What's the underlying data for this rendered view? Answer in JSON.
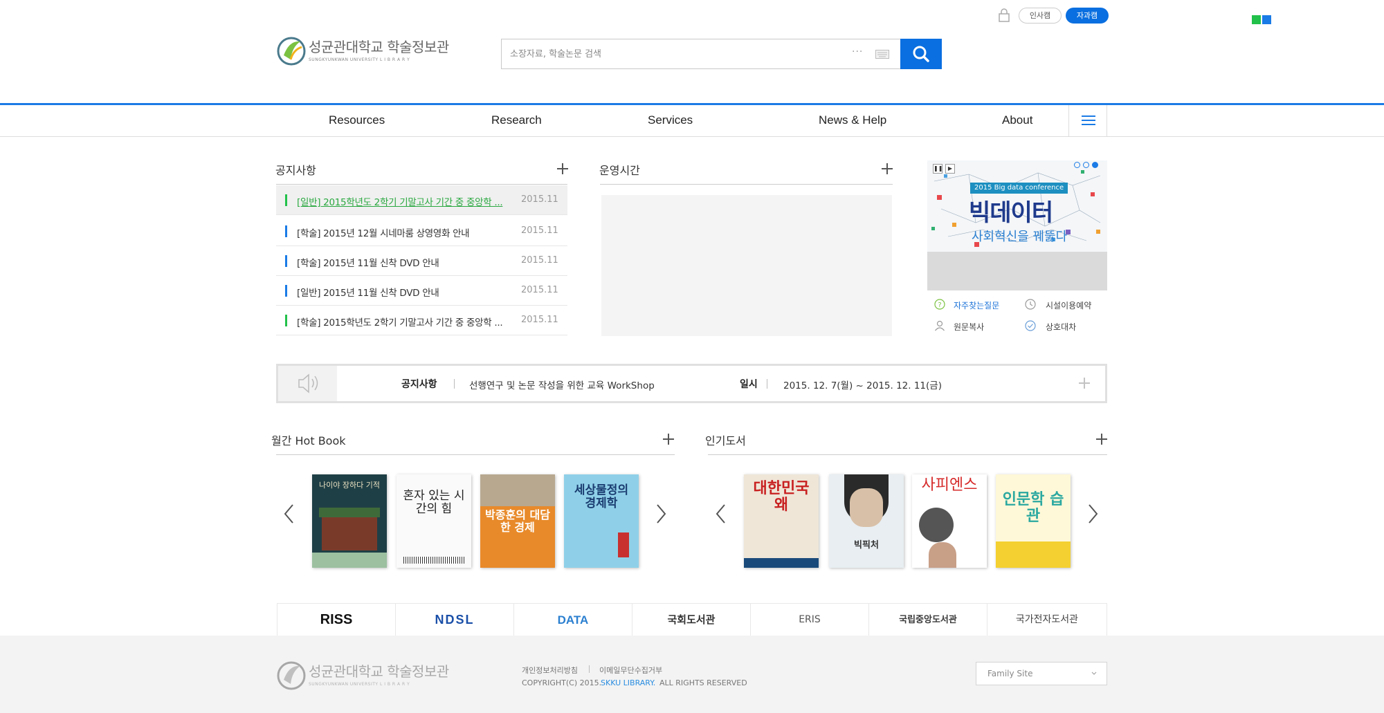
{
  "header": {
    "btn_insa": "인사캠",
    "btn_jagwa": "자과캠",
    "logo_text": "성균관대학교 학술정보관",
    "logo_sub": "SUNGKYUNKWAN UNIVERSITY   L I B R A R Y",
    "search_placeholder": "소장자료, 학술논문 검색",
    "search_more": "···",
    "brand_blue": "#0a6fe0",
    "accent_green": "#21c14a"
  },
  "nav": {
    "items": [
      "Resources",
      "Research",
      "Services",
      "News & Help",
      "About"
    ]
  },
  "notices": {
    "title": "공지사항",
    "items": [
      {
        "text": "[일반] 2015학년도 2학기 기말고사 기간 중 중앙학 ...",
        "date": "2015.11"
      },
      {
        "text": "[학술] 2015년 12월 시네마룸 상영영화 안내",
        "date": "2015.11"
      },
      {
        "text": "[학술] 2015년 11월 신착 DVD 안내",
        "date": "2015.11"
      },
      {
        "text": "[일반] 2015년 11월 신착 DVD 안내",
        "date": "2015.11"
      },
      {
        "text": "[학술] 2015학년도 2학기 기말고사 기간 중 중앙학 ...",
        "date": "2015.11"
      }
    ]
  },
  "hours": {
    "title": "운영시간"
  },
  "banner": {
    "tag": "2015 Big data conference",
    "title": "빅데이터",
    "subtitle": "사회혁신을 꿰뚫다"
  },
  "quick": {
    "faq": "자주찾는질문",
    "facility": "시설이용예약",
    "copy": "원문복사",
    "ill": "상호대차"
  },
  "strip": {
    "label": "공지사항",
    "text": "선행연구 및 논문 작성을 위한 교육 WorkShop",
    "date_label": "일시",
    "date": "2015. 12. 7(월) ~ 2015. 12. 11(금)"
  },
  "hotbook": {
    "title": "월간 Hot Book",
    "books": [
      "나이야 장하다 기적",
      "혼자 있는 시간의 힘",
      "박종훈의 대담한 경제",
      "세상물정의 경제학"
    ]
  },
  "popular": {
    "title": "인기도서",
    "books": [
      "대한민국 왜",
      "빅픽처",
      "사피엔스",
      "인문학 습관"
    ]
  },
  "links": [
    "RISS",
    "NDSL",
    "DATA",
    "국회도서관",
    "ERIS",
    "국립중앙도서관",
    "국가전자도서관"
  ],
  "footer": {
    "privacy": "개인정보처리방침",
    "email": "이메일무단수집거부",
    "copyright_pre": "COPYRIGHT(C) 2015.",
    "copyright_link": "SKKU LIBRARY.",
    "copyright_post": "ALL RIGHTS RESERVED",
    "family": "Family Site"
  }
}
